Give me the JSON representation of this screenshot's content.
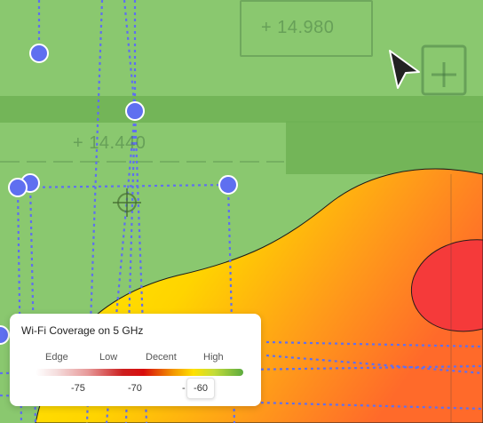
{
  "floorplan": {
    "dimension_top": "+ 14.980",
    "dimension_mid": "+ 14.440"
  },
  "legend": {
    "title": "Wi-Fi Coverage on 5 GHz",
    "categories": [
      "Edge",
      "Low",
      "Decent",
      "High"
    ],
    "ticks": [
      "-75",
      "-70",
      "-"
    ],
    "current_value": "-60"
  },
  "colors": {
    "high": "#8ac86f",
    "decent": "#ffe100",
    "low": "#f39400",
    "edge": "#f53a3a",
    "anchor": "#5f6ff0"
  },
  "icons": {
    "cursor": "arrow-cursor-icon",
    "crosshair": "crosshair-icon",
    "plus": "plus-square-icon"
  }
}
